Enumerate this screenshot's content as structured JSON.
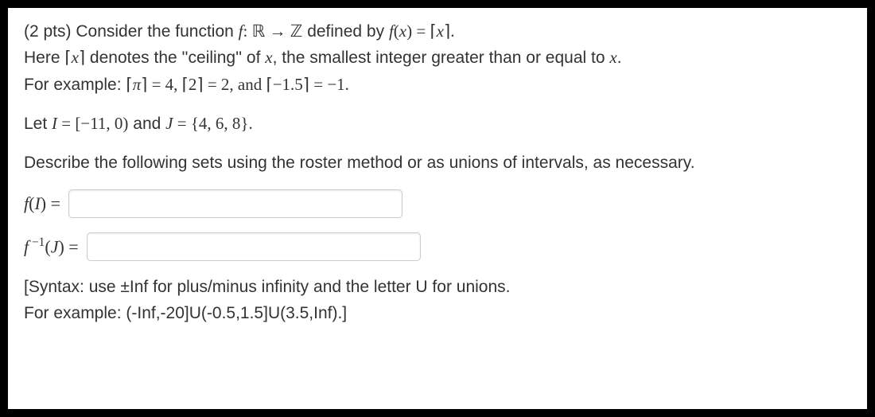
{
  "problem": {
    "points_prefix": "(2 pts) Consider the function ",
    "func_def_1": "f",
    "func_def_colon": ": ",
    "domain_set": "ℝ",
    "arrow": " → ",
    "codomain_set": "ℤ",
    "defined_by": " defined by ",
    "func_expr_f": "f",
    "func_expr_paren_open": "(",
    "func_expr_x": "x",
    "func_expr_paren_close": ") = ",
    "ceil_open": "⌈",
    "ceil_x": "x",
    "ceil_close": "⌉",
    "period1": ".",
    "line2_here": "Here ",
    "line2_ceil_open": "⌈",
    "line2_x": "x",
    "line2_ceil_close": "⌉",
    "line2_denotes": " denotes the ''ceiling'' of ",
    "line2_x2": "x",
    "line2_rest": ", the smallest integer greater than or equal to ",
    "line2_x3": "x",
    "line2_period": ".",
    "line3_prefix": "For example: ",
    "ex1_open": "⌈",
    "ex1_val": "π",
    "ex1_close": "⌉",
    "ex1_eq": " = 4, ",
    "ex2_open": "⌈",
    "ex2_val": "2",
    "ex2_close": "⌉",
    "ex2_eq": " = 2, and ",
    "ex3_open": "⌈",
    "ex3_val": "−1.5",
    "ex3_close": "⌉",
    "ex3_eq": " = −1.",
    "let_line_1": "Let ",
    "let_I": "I",
    "let_eq1": " = ",
    "interval_I": "[−11, 0)",
    "let_and": " and ",
    "let_J": "J",
    "let_eq2": " = ",
    "set_J": "{4, 6, 8}",
    "let_period": ".",
    "describe": "Describe the following sets using the roster method or as unions of intervals, as necessary."
  },
  "answers": {
    "fI_label_f": "f",
    "fI_label_paren": "(",
    "fI_label_I": "I",
    "fI_label_close": ") =",
    "fI_value": "",
    "finvJ_label_f": "f",
    "finvJ_sup": " −1",
    "finvJ_paren": "(",
    "finvJ_J": "J",
    "finvJ_close": ") =",
    "finvJ_value": ""
  },
  "syntax": {
    "line1": "[Syntax: use ±Inf for plus/minus infinity and the letter U for unions.",
    "line2": "For example: (-Inf,-20]U(-0.5,1.5]U(3.5,Inf).]"
  }
}
